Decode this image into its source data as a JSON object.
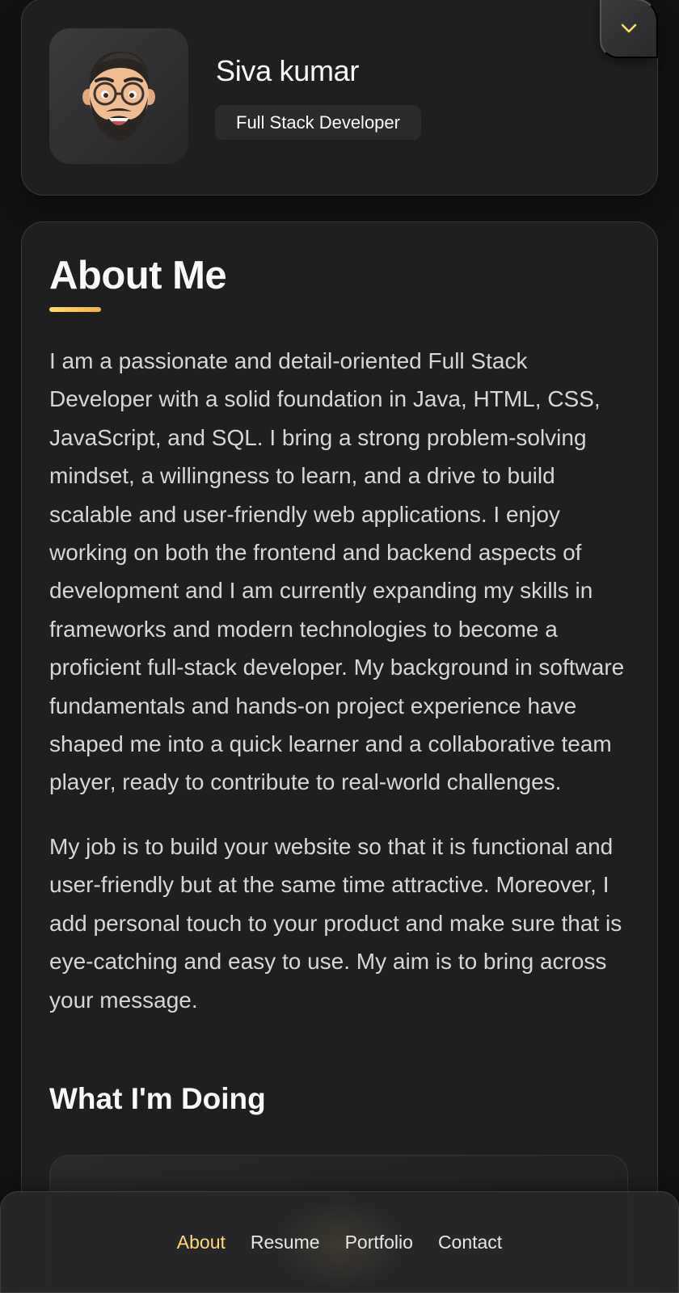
{
  "profile": {
    "name": "Siva kumar",
    "title": "Full Stack Developer",
    "avatar_icon": "memoji-avatar-icon",
    "toggle_icon": "chevron-down-icon",
    "accent_color": "#ffdb70"
  },
  "about": {
    "heading": "About Me",
    "paragraphs": [
      "I am a passionate and detail-oriented Full Stack Developer with a solid foundation in Java, HTML, CSS, JavaScript, and SQL. I bring a strong problem-solving mindset, a willingness to learn, and a drive to build scalable and user-friendly web applications. I enjoy working on both the frontend and backend aspects of development and I am currently expanding my skills in frameworks and modern technologies to become a proficient full-stack developer. My background in software fundamentals and hands-on project experience have shaped me into a quick learner and a collaborative team player, ready to contribute to real-world challenges.",
      "My job is to build your website so that it is functional and user-friendly but at the same time attractive. Moreover, I add personal touch to your product and make sure that is eye-catching and easy to use. My aim is to bring across your message."
    ],
    "services_heading": "What I'm Doing"
  },
  "navbar": {
    "items": [
      {
        "label": "About",
        "active": true
      },
      {
        "label": "Resume",
        "active": false
      },
      {
        "label": "Portfolio",
        "active": false
      },
      {
        "label": "Contact",
        "active": false
      }
    ]
  }
}
